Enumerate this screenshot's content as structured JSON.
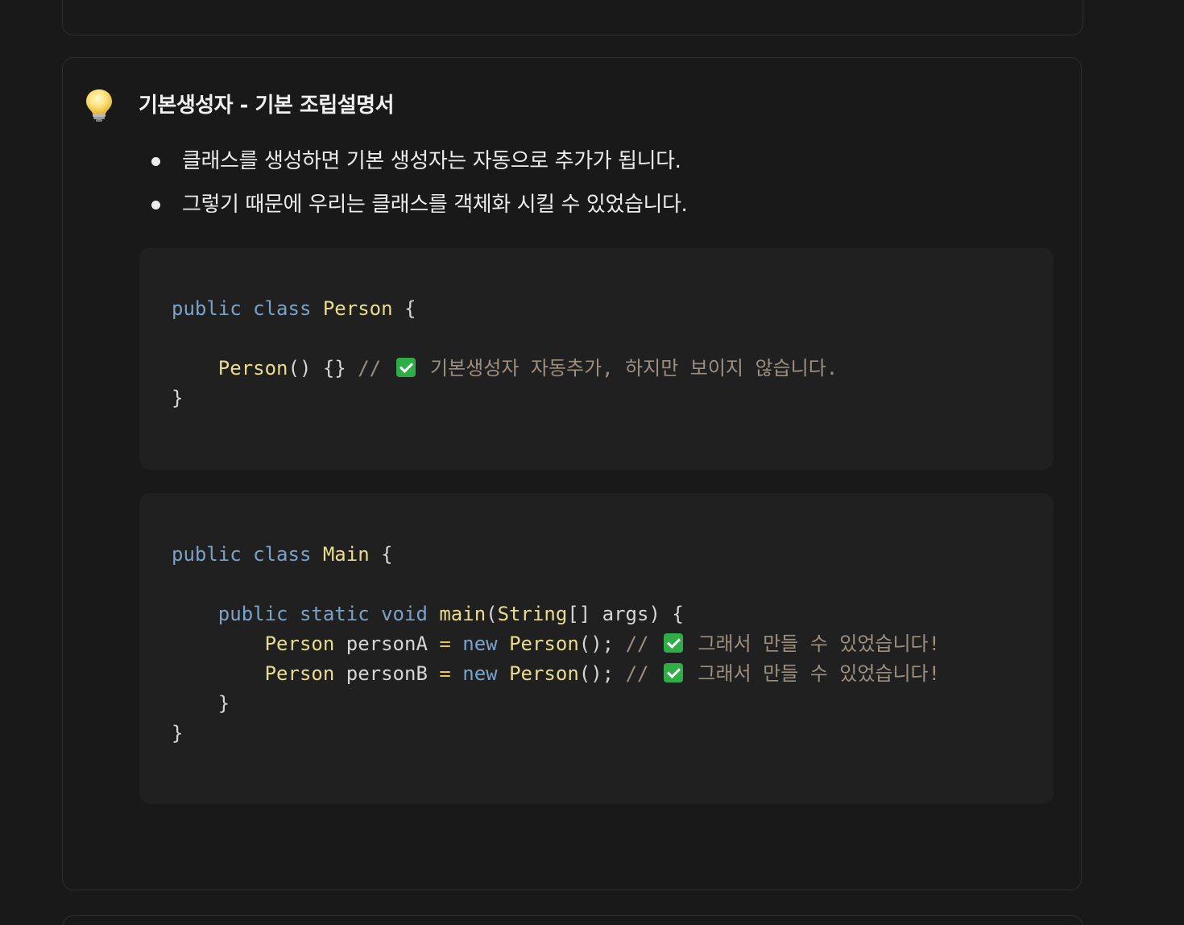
{
  "callout": {
    "icon": "lightbulb-icon",
    "title": "기본생성자 - 기본 조립설명서",
    "bullets": [
      "클래스를 생성하면 기본 생성자는 자동으로 추가가 됩니다.",
      "그렇기 때문에 우리는 클래스를 객체화 시킬 수 있었습니다."
    ]
  },
  "code1": {
    "l1": {
      "kw1": "public",
      "kw2": "class",
      "name": "Person",
      "brace": "{"
    },
    "l3": {
      "ctor": "Person",
      "rest": "() {}",
      "slashes": "//",
      "comment": "기본생성자 자동추가, 하지만 보이지 않습니다."
    },
    "l4": {
      "brace": "}"
    }
  },
  "code2": {
    "l1": {
      "kw1": "public",
      "kw2": "class",
      "name": "Main",
      "brace": "{"
    },
    "l3": {
      "kw1": "public",
      "kw2": "static",
      "kw3": "void",
      "method": "main",
      "p1": "(",
      "type": "String",
      "p2": "[] args) {"
    },
    "l4": {
      "type": "Person",
      "var": "personA",
      "eq": "=",
      "newkw": "new",
      "ctor": "Person",
      "rest": "();",
      "slashes": "//",
      "comment": "그래서 만들 수 있었습니다!"
    },
    "l5": {
      "type": "Person",
      "var": "personB",
      "eq": "=",
      "newkw": "new",
      "ctor": "Person",
      "rest": "();",
      "slashes": "//",
      "comment": "그래서 만들 수 있었습니다!"
    },
    "l6": {
      "brace": "}"
    },
    "l7": {
      "brace": "}"
    }
  },
  "colors": {
    "background": "#191919",
    "keyword": "#7aa2c9",
    "class_name": "#e9dc8a",
    "operator": "#e6c35c",
    "comment": "#9d8f80",
    "check": "#2fae47"
  }
}
